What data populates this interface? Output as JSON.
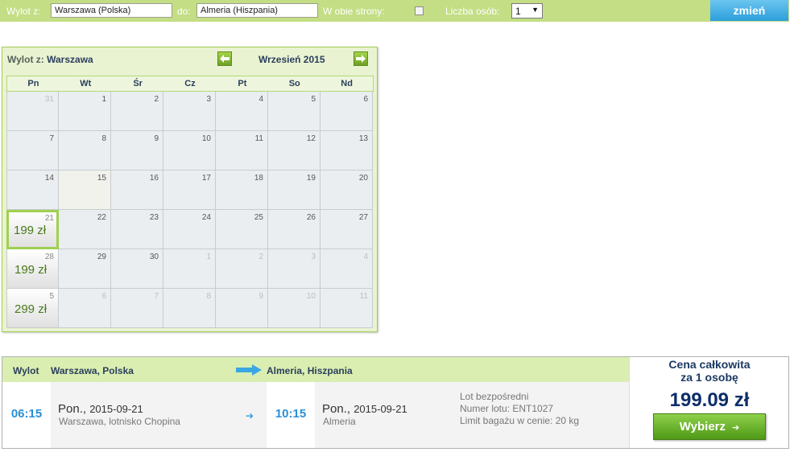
{
  "search": {
    "from_label": "Wylot z:",
    "from_value": "Warszawa (Polska)",
    "to_label": "do:",
    "to_value": "Almeria (Hiszpania)",
    "roundtrip_label": "W obie strony:",
    "roundtrip_checked": false,
    "passengers_label": "Liczba osób:",
    "passengers_value": "1",
    "change_button": "zmień"
  },
  "calendar": {
    "departure_label": "Wylot z:",
    "departure_city": "Warszawa",
    "month_title": "Wrzesień 2015",
    "prev_icon": "arrow-left-icon",
    "next_icon": "arrow-right-icon",
    "weekdays": [
      "Pn",
      "Wt",
      "Śr",
      "Cz",
      "Pt",
      "So",
      "Nd"
    ],
    "weeks": [
      [
        {
          "d": "31",
          "o": true
        },
        {
          "d": "1"
        },
        {
          "d": "2"
        },
        {
          "d": "3"
        },
        {
          "d": "4"
        },
        {
          "d": "5"
        },
        {
          "d": "6"
        }
      ],
      [
        {
          "d": "7"
        },
        {
          "d": "8"
        },
        {
          "d": "9"
        },
        {
          "d": "10"
        },
        {
          "d": "11"
        },
        {
          "d": "12"
        },
        {
          "d": "13"
        }
      ],
      [
        {
          "d": "14"
        },
        {
          "d": "15",
          "h": true
        },
        {
          "d": "16"
        },
        {
          "d": "17"
        },
        {
          "d": "18"
        },
        {
          "d": "19"
        },
        {
          "d": "20"
        }
      ],
      [
        {
          "d": "21",
          "p": "199 zł",
          "s": true
        },
        {
          "d": "22"
        },
        {
          "d": "23"
        },
        {
          "d": "24"
        },
        {
          "d": "25"
        },
        {
          "d": "26"
        },
        {
          "d": "27"
        }
      ],
      [
        {
          "d": "28",
          "p": "199 zł"
        },
        {
          "d": "29"
        },
        {
          "d": "30"
        },
        {
          "d": "1",
          "o": true
        },
        {
          "d": "2",
          "o": true
        },
        {
          "d": "3",
          "o": true
        },
        {
          "d": "4",
          "o": true
        }
      ],
      [
        {
          "d": "5",
          "o": true,
          "p": "299 zł"
        },
        {
          "d": "6",
          "o": true
        },
        {
          "d": "7",
          "o": true
        },
        {
          "d": "8",
          "o": true
        },
        {
          "d": "9",
          "o": true
        },
        {
          "d": "10",
          "o": true
        },
        {
          "d": "11",
          "o": true
        }
      ]
    ]
  },
  "flight": {
    "header_label": "Wylot",
    "origin": "Warszawa, Polska",
    "destination": "Almeria, Hiszpania",
    "departure_time": "06:15",
    "departure_day": "Pon.,",
    "departure_date": "2015-09-21",
    "departure_airport": "Warszawa, lotnisko Chopina",
    "arrival_time": "10:15",
    "arrival_day": "Pon.,",
    "arrival_date": "2015-09-21",
    "arrival_airport": "Almeria",
    "info": [
      "Lot bezpośredni",
      "Numer lotu: ENT1027",
      "Limit bagażu w cenie: 20 kg"
    ],
    "total_label_1": "Cena całkowita",
    "total_label_2": "za 1 osobę",
    "total_price": "199.09 zł",
    "select_button": "Wybierz"
  },
  "colors": {
    "bar_green": "#c3de84",
    "accent_blue": "#2a8fd6",
    "price_green": "#4a7a1c",
    "button_green": "#5da81f"
  }
}
